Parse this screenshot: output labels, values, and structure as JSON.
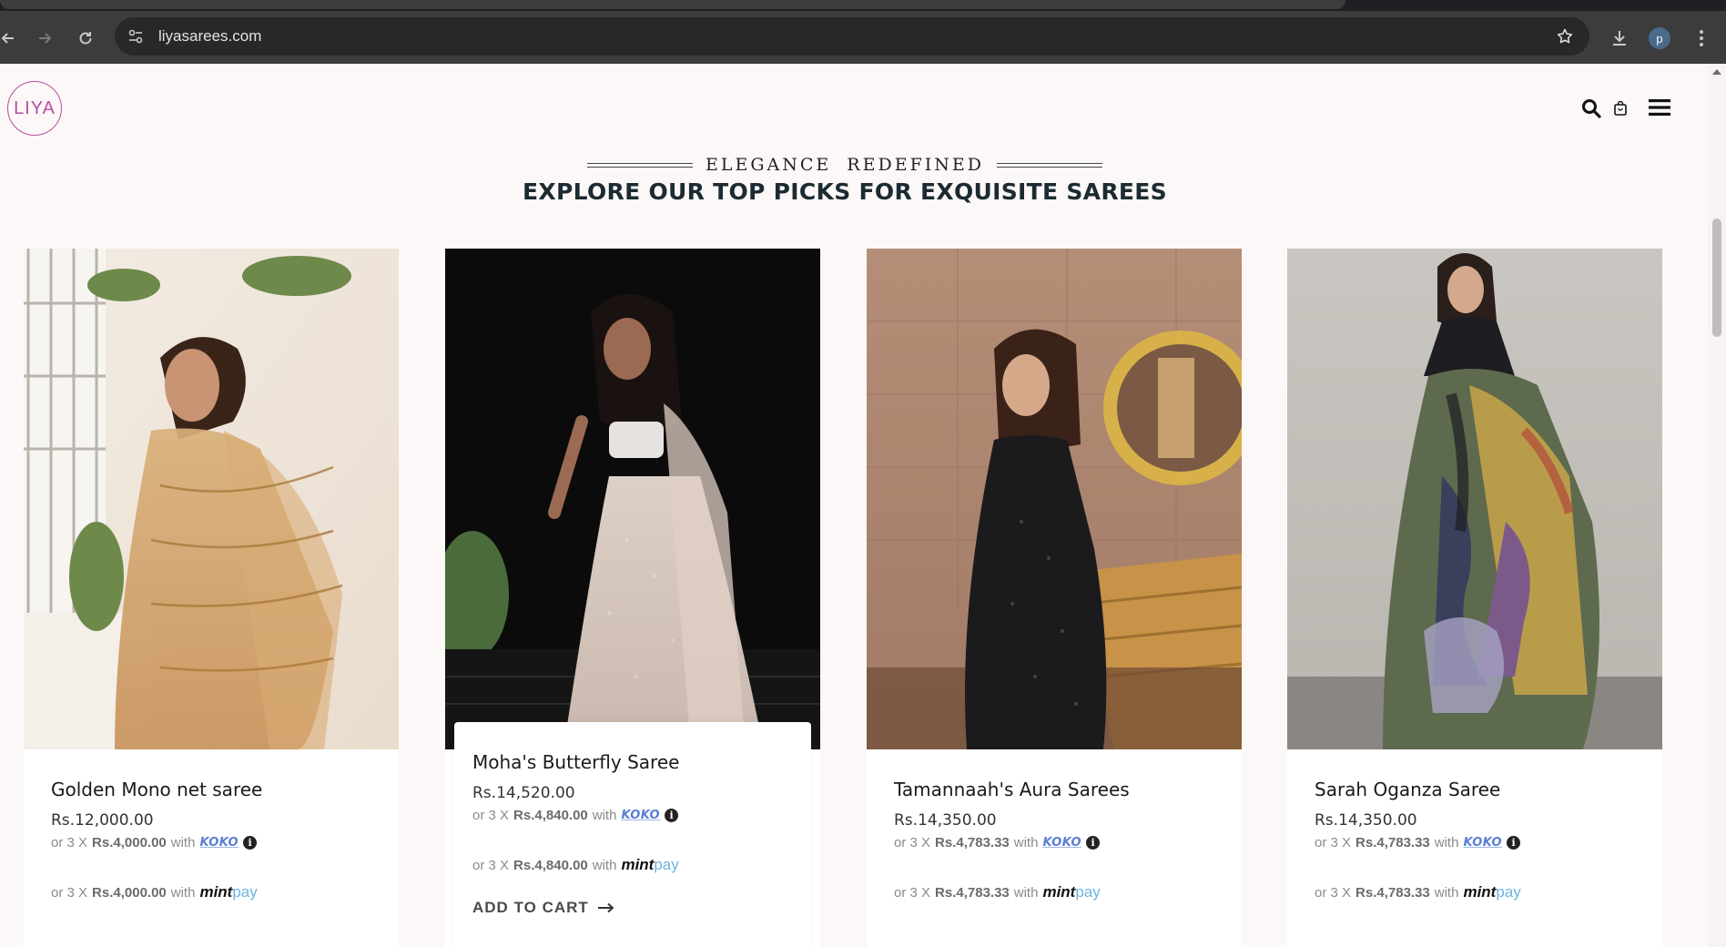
{
  "browser": {
    "url": "liyasarees.com",
    "profile_initial": "p"
  },
  "site": {
    "logo_text": "LIYA"
  },
  "section": {
    "eyebrow": "ELEGANCE REDEFINED",
    "headline": "EXPLORE OUR TOP PICKS FOR EXQUISITE SAREES"
  },
  "products": [
    {
      "name": "Golden Mono net saree",
      "price": "Rs.12,000.00",
      "installment_prefix": "or 3 X",
      "installment_amount": "Rs.4,000.00",
      "with_label": "with",
      "koko_label": "KOKO",
      "mintpay_a": "mint",
      "mintpay_b": "pay"
    },
    {
      "name": "Moha's Butterfly Saree",
      "price": "Rs.14,520.00",
      "installment_prefix": "or 3 X",
      "installment_amount": "Rs.4,840.00",
      "with_label": "with",
      "koko_label": "KOKO",
      "mintpay_a": "mint",
      "mintpay_b": "pay",
      "cta": "ADD TO CART"
    },
    {
      "name": "Tamannaah's Aura Sarees",
      "price": "Rs.14,350.00",
      "installment_prefix": "or 3 X",
      "installment_amount": "Rs.4,783.33",
      "with_label": "with",
      "koko_label": "KOKO",
      "mintpay_a": "mint",
      "mintpay_b": "pay"
    },
    {
      "name": "Sarah Oganza Saree",
      "price": "Rs.14,350.00",
      "installment_prefix": "or 3 X",
      "installment_amount": "Rs.4,783.33",
      "with_label": "with",
      "koko_label": "KOKO",
      "mintpay_a": "mint",
      "mintpay_b": "pay"
    }
  ],
  "colors": {
    "brand": "#b84ea0",
    "heading": "#1c2b33",
    "page_bg": "#fcf8f7"
  }
}
